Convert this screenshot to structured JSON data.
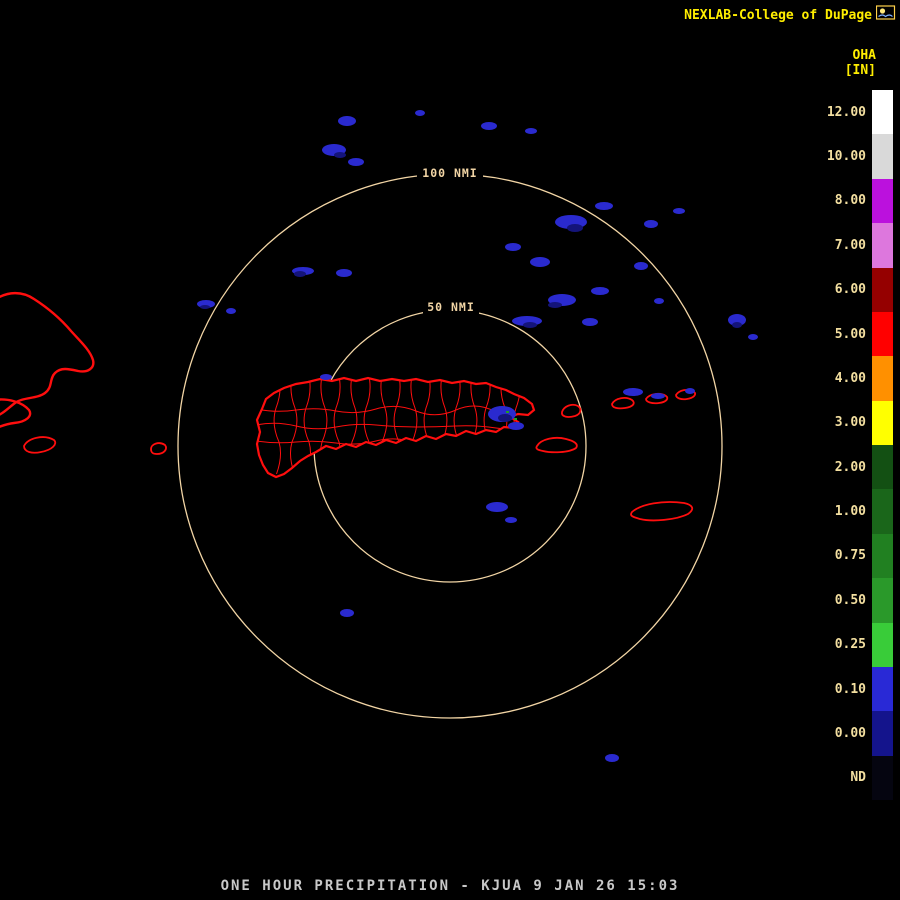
{
  "header": {
    "title": "NEXLAB-College of DuPage"
  },
  "legend": {
    "product": "OHA",
    "units": "[IN]",
    "entries": [
      {
        "label": "12.00",
        "color": "#FFFFFF"
      },
      {
        "label": "10.00",
        "color": "#D9D9D9"
      },
      {
        "label": "8.00",
        "color": "#BB11DD"
      },
      {
        "label": "7.00",
        "color": "#DD77DD"
      },
      {
        "label": "6.00",
        "color": "#950000"
      },
      {
        "label": "5.00",
        "color": "#FF0000"
      },
      {
        "label": "4.00",
        "color": "#FF9000"
      },
      {
        "label": "3.00",
        "color": "#FFFF00"
      },
      {
        "label": "2.00",
        "color": "#135013"
      },
      {
        "label": "1.00",
        "color": "#1A661A"
      },
      {
        "label": "0.75",
        "color": "#218021"
      },
      {
        "label": "0.50",
        "color": "#2A992A"
      },
      {
        "label": "0.25",
        "color": "#39CC39"
      },
      {
        "label": "0.10",
        "color": "#2929D6"
      },
      {
        "label": "0.00",
        "color": "#14148C"
      },
      {
        "label": "ND",
        "color": "#050510"
      }
    ]
  },
  "map": {
    "ring_labels": {
      "outer": "100 NMI",
      "inner": "50 NMI"
    }
  },
  "footer": {
    "caption": "ONE HOUR PRECIPITATION - KJUA 9 JAN 26 15:03"
  },
  "colors": {
    "ring": "#F2D5A5",
    "boundary": "#FF0E0E",
    "echo": "#2A2ACF",
    "echo_dark": "#14147A",
    "echo_green": "#1FA01F",
    "scale_text": "#F3DFA0",
    "header_text": "#FFEE00",
    "caption_text": "#C8C8C8"
  }
}
